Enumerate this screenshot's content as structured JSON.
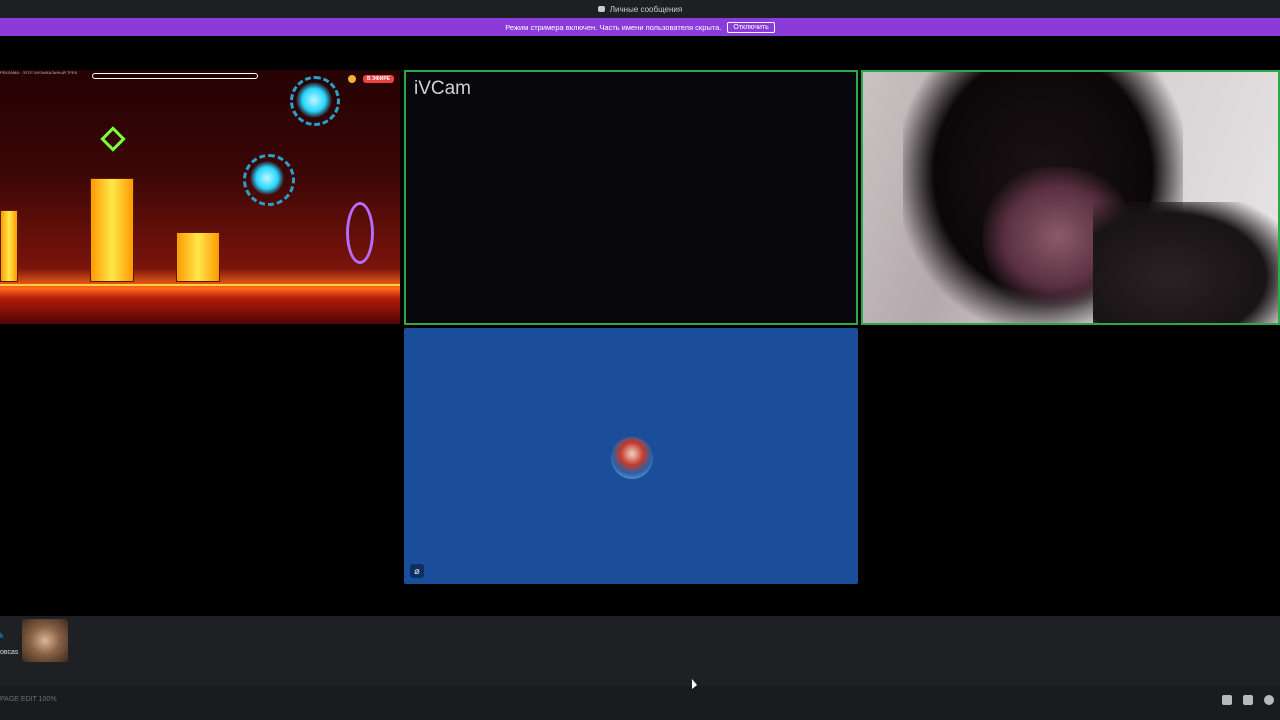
{
  "titlebar": {
    "title": "Личные сообщения",
    "icon": "discord-icon"
  },
  "streamer_bar": {
    "message": "Режим стримера включен. Часть имени пользователя скрыта.",
    "button_label": "Отключить",
    "color": "#8c3bdb"
  },
  "tiles": {
    "game": {
      "live_badge": "В ЭФИРЕ",
      "hud_text": "РЕКЛАМА · ЭТОТ МУЗЫКАЛЬНЫЙ ТРЕК"
    },
    "ivcam": {
      "label": "iVCam"
    },
    "avatar": {
      "bg_color": "#1a4e9b",
      "mute_icon": "muted-mic-icon"
    }
  },
  "participant": {
    "name": "k",
    "subtitle": "овсаs"
  },
  "footer": {
    "status": "PAGE EDIT 100%"
  },
  "speaking_border_color": "#2fa84a"
}
